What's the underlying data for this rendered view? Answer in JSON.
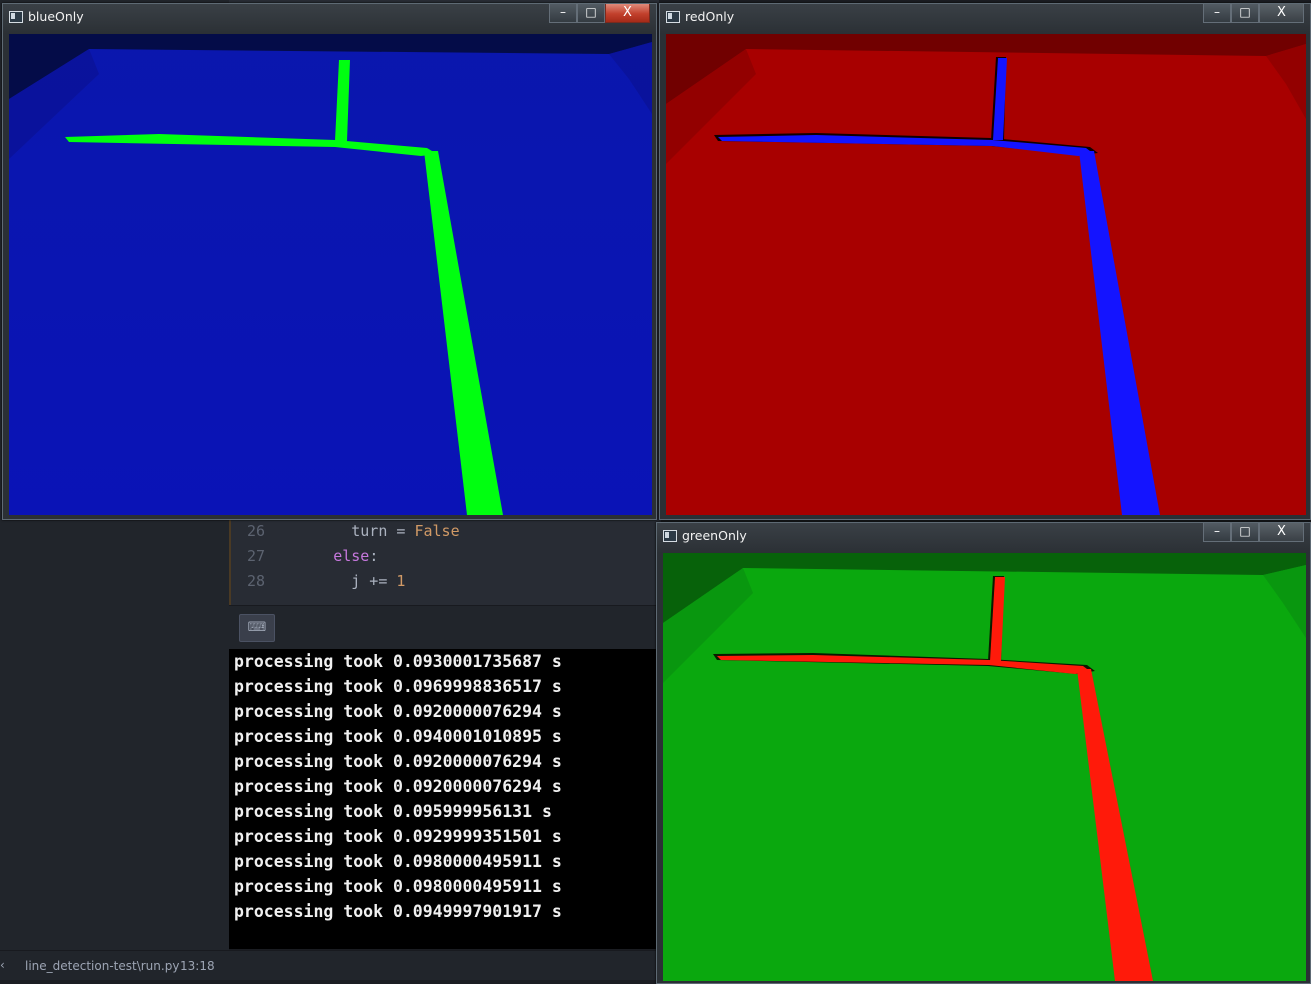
{
  "editor": {
    "code_lines": [
      {
        "num": "26",
        "indent": "        ",
        "tokens": [
          {
            "text": "turn",
            "cls": "pl"
          },
          {
            "text": " = ",
            "cls": "op"
          },
          {
            "text": "False",
            "cls": "bool"
          }
        ]
      },
      {
        "num": "27",
        "indent": "      ",
        "tokens": [
          {
            "text": "else",
            "cls": "kw"
          },
          {
            "text": ":",
            "cls": "op"
          }
        ]
      },
      {
        "num": "28",
        "indent": "        ",
        "tokens": [
          {
            "text": "j",
            "cls": "pl"
          },
          {
            "text": " += ",
            "cls": "op"
          },
          {
            "text": "1",
            "cls": "num"
          }
        ]
      }
    ],
    "keyboard_icon": "keyboard-icon"
  },
  "terminal": {
    "lines": [
      "processing took 0.0930001735687 s",
      "processing took 0.0969998836517 s",
      "processing took 0.0920000076294 s",
      "processing took 0.0940001010895 s",
      "processing took 0.0920000076294 s",
      "processing took 0.0920000076294 s",
      "processing took 0.095999956131 s",
      "processing took 0.0929999351501 s",
      "processing took 0.0980000495911 s",
      "processing took 0.0980000495911 s",
      "processing took 0.0949997901917 s"
    ]
  },
  "statusbar": {
    "file_path": "line_detection-test\\run.py",
    "cursor_position": "13:18"
  },
  "windows": {
    "blue": {
      "title": "blueOnly",
      "minimize_label": "–",
      "maximize_label": "□",
      "close_label": "X",
      "background_color": "#0a12b4",
      "line_color": "#00ff10"
    },
    "red": {
      "title": "redOnly",
      "minimize_label": "–",
      "maximize_label": "□",
      "close_label": "X",
      "background_color": "#a80000",
      "line_color": "#1414ff"
    },
    "green": {
      "title": "greenOnly",
      "minimize_label": "–",
      "maximize_label": "□",
      "close_label": "X",
      "background_color": "#0aa80e",
      "line_color": "#ff1a0a"
    }
  }
}
